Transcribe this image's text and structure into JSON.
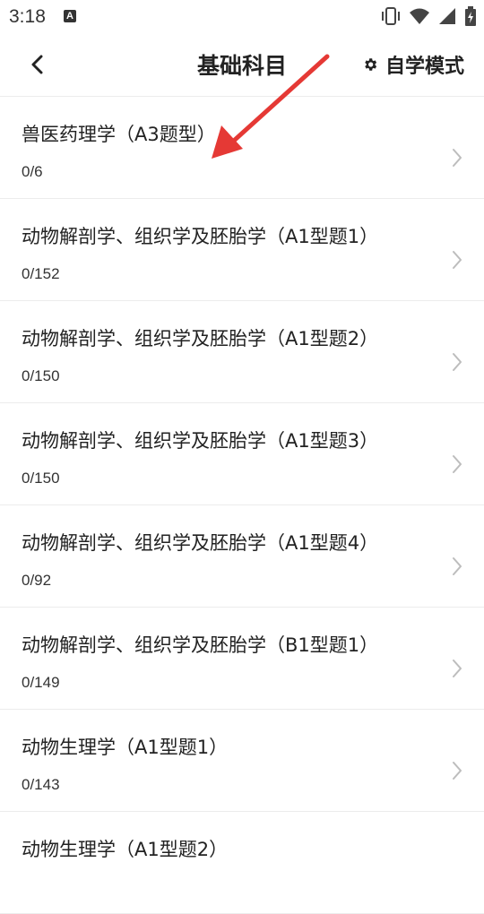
{
  "status_bar": {
    "time": "3:18",
    "notification_icon": "A",
    "icons": [
      "vibrate-icon",
      "wifi-icon",
      "signal-icon",
      "battery-icon"
    ]
  },
  "header": {
    "title": "基础科目",
    "mode_label": "自学模式",
    "back_icon": "chevron-left-icon",
    "mode_icon": "gear-icon"
  },
  "annotation": {
    "arrow_color": "#e53935"
  },
  "items": [
    {
      "title": "兽医药理学（A3题型）",
      "progress": "0/6"
    },
    {
      "title": "动物解剖学、组织学及胚胎学（A1型题1）",
      "progress": "0/152"
    },
    {
      "title": "动物解剖学、组织学及胚胎学（A1型题2）",
      "progress": "0/150"
    },
    {
      "title": "动物解剖学、组织学及胚胎学（A1型题3）",
      "progress": "0/150"
    },
    {
      "title": "动物解剖学、组织学及胚胎学（A1型题4）",
      "progress": "0/92"
    },
    {
      "title": "动物解剖学、组织学及胚胎学（B1型题1）",
      "progress": "0/149"
    },
    {
      "title": "动物生理学（A1型题1）",
      "progress": "0/143"
    },
    {
      "title": "动物生理学（A1型题2）",
      "progress": ""
    }
  ]
}
